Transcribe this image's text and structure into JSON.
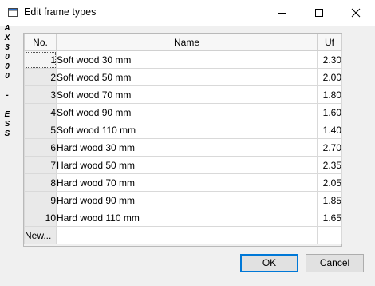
{
  "window": {
    "title": "Edit frame types"
  },
  "side_label": {
    "text": [
      "A",
      "X",
      "3",
      "0",
      "0",
      "0",
      "",
      "-",
      "",
      "E",
      "S",
      "S"
    ]
  },
  "grid": {
    "headers": {
      "no": "No.",
      "name": "Name",
      "uf": "Uf"
    },
    "rows": [
      {
        "no": "1",
        "name": "Soft wood 30 mm",
        "uf": "2.30"
      },
      {
        "no": "2",
        "name": "Soft wood 50 mm",
        "uf": "2.00"
      },
      {
        "no": "3",
        "name": "Soft wood 70 mm",
        "uf": "1.80"
      },
      {
        "no": "4",
        "name": "Soft wood 90 mm",
        "uf": "1.60"
      },
      {
        "no": "5",
        "name": "Soft wood 110 mm",
        "uf": "1.40"
      },
      {
        "no": "6",
        "name": "Hard wood 30 mm",
        "uf": "2.70"
      },
      {
        "no": "7",
        "name": "Hard wood 50 mm",
        "uf": "2.35"
      },
      {
        "no": "8",
        "name": "Hard wood 70 mm",
        "uf": "2.05"
      },
      {
        "no": "9",
        "name": "Hard wood 90 mm",
        "uf": "1.85"
      },
      {
        "no": "10",
        "name": "Hard wood 110 mm",
        "uf": "1.65"
      }
    ],
    "new_row_label": "New..."
  },
  "buttons": {
    "ok": "OK",
    "cancel": "Cancel"
  },
  "icons": {
    "app": "window-app-icon",
    "minimize": "minimize-icon",
    "maximize": "maximize-icon",
    "close": "close-icon"
  }
}
